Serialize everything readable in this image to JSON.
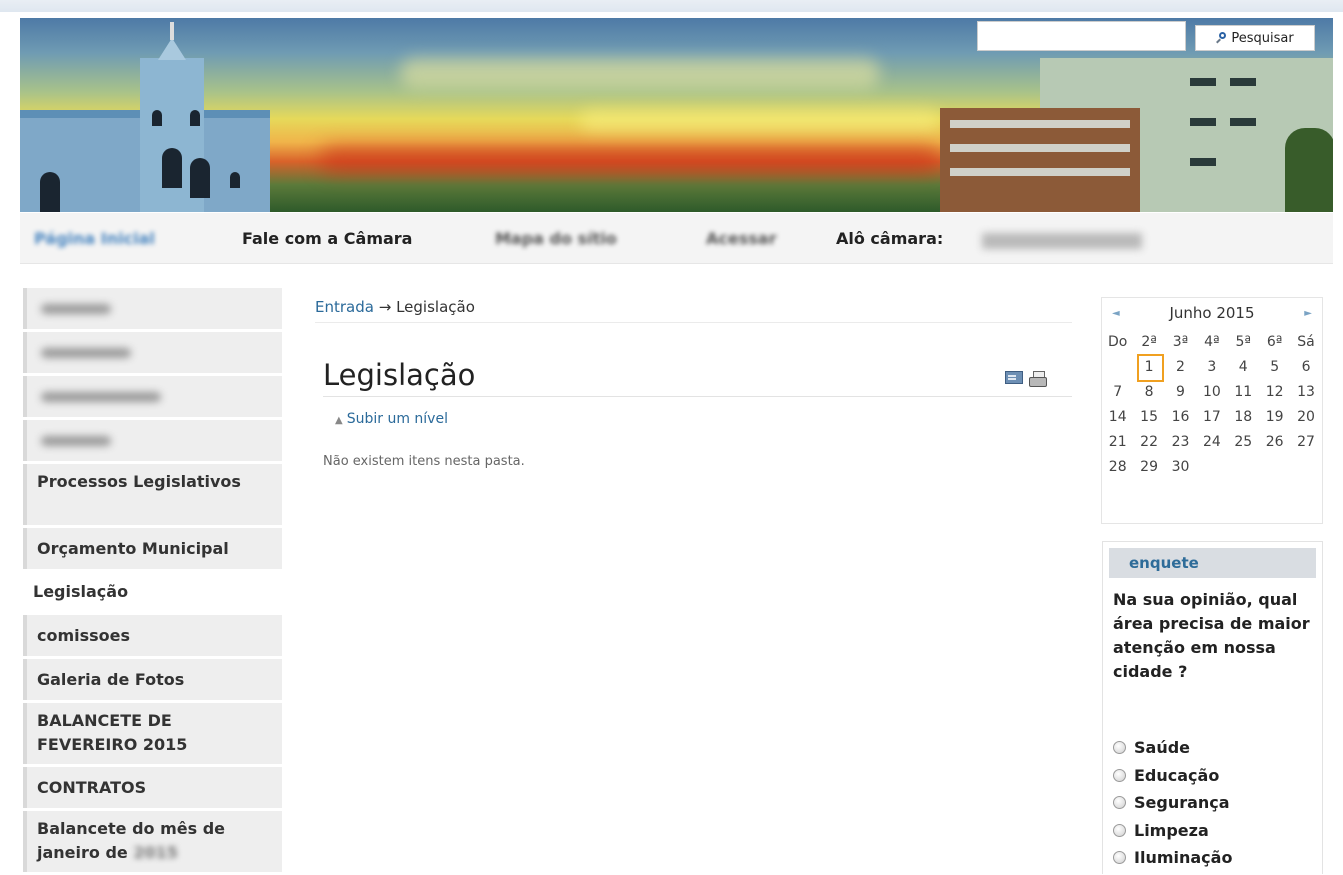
{
  "header": {
    "search_placeholder": "",
    "search_button_label": "Pesquisar"
  },
  "nav": {
    "items": [
      {
        "label": "Página Inicial"
      },
      {
        "label": "Fale com a Câmara"
      },
      {
        "label": "Mapa do sítio"
      },
      {
        "label": "Acessar"
      },
      {
        "label": "Alô câmara:"
      }
    ]
  },
  "sidebar": {
    "items": [
      {
        "label": "Processos Legislativos"
      },
      {
        "label": "Orçamento Municipal"
      },
      {
        "label": "Legislação"
      },
      {
        "label": "comissoes"
      },
      {
        "label": "Galeria de Fotos"
      },
      {
        "label": "BALANCETE DE FEVEREIRO 2015"
      },
      {
        "label": "CONTRATOS"
      },
      {
        "label": "Balancete do mês de janeiro de"
      }
    ]
  },
  "breadcrumb": {
    "home": "Entrada",
    "separator": "→",
    "current": "Legislação"
  },
  "main": {
    "title": "Legislação",
    "up_level": "Subir um nível",
    "empty_message": "Não existem itens nesta pasta."
  },
  "calendar": {
    "month": "Junho 2015",
    "prev": "◄",
    "next": "►",
    "weekdays": [
      "Do",
      "2ª",
      "3ª",
      "4ª",
      "5ª",
      "6ª",
      "Sá"
    ],
    "weeks": [
      [
        "",
        "1",
        "2",
        "3",
        "4",
        "5",
        "6"
      ],
      [
        "7",
        "8",
        "9",
        "10",
        "11",
        "12",
        "13"
      ],
      [
        "14",
        "15",
        "16",
        "17",
        "18",
        "19",
        "20"
      ],
      [
        "21",
        "22",
        "23",
        "24",
        "25",
        "26",
        "27"
      ],
      [
        "28",
        "29",
        "30",
        "",
        "",
        "",
        ""
      ]
    ],
    "today": "1",
    "today_color": "#f0a020"
  },
  "poll": {
    "title": "enquete",
    "question": "Na sua opinião, qual área precisa de maior atenção em nossa cidade ?",
    "options": [
      "Saúde",
      "Educação",
      "Segurança",
      "Limpeza",
      "Iluminação"
    ]
  },
  "colors": {
    "link": "#2b6a9a",
    "nav_active": "#4a86c0",
    "poll_head_bg": "#d9dde2"
  }
}
